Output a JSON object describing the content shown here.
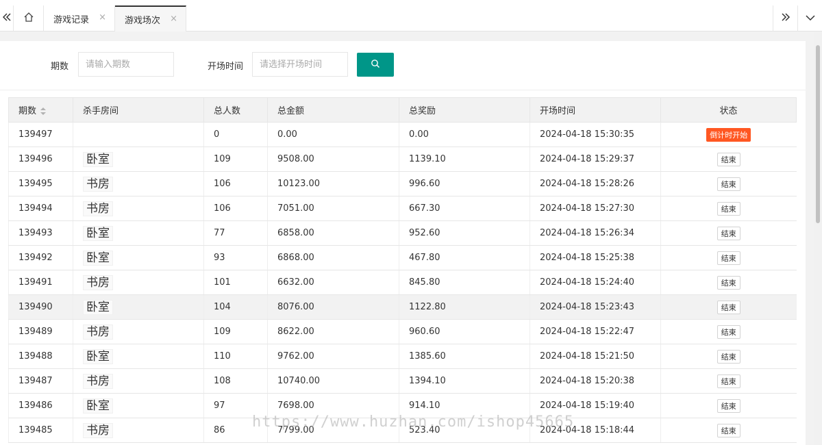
{
  "tabs": [
    {
      "label": "游戏记录",
      "close": "×",
      "active": false
    },
    {
      "label": "游戏场次",
      "close": "×",
      "active": true
    }
  ],
  "icons": {
    "prev": "chevron-double-left-icon",
    "home": "home-icon",
    "next": "chevron-double-right-icon",
    "dropdown": "chevron-down-icon",
    "search": "search-icon"
  },
  "search": {
    "period_label": "期数",
    "period_placeholder": "请输入期数",
    "time_label": "开场时间",
    "time_placeholder": "请选择开场时间"
  },
  "colors": {
    "accent": "#009688",
    "active_badge": "#ff5722"
  },
  "table": {
    "headers": [
      "期数",
      "杀手房间",
      "总人数",
      "总金额",
      "总奖励",
      "开场时间",
      "状态"
    ],
    "rows": [
      {
        "period": "139497",
        "room": "",
        "players": "0",
        "amount": "0.00",
        "reward": "0.00",
        "time": "2024-04-18 15:30:35",
        "status": "倒计时开始",
        "status_type": "active"
      },
      {
        "period": "139496",
        "room": "卧室",
        "players": "109",
        "amount": "9508.00",
        "reward": "1139.10",
        "time": "2024-04-18 15:29:37",
        "status": "结束",
        "status_type": "end"
      },
      {
        "period": "139495",
        "room": "书房",
        "players": "106",
        "amount": "10123.00",
        "reward": "996.60",
        "time": "2024-04-18 15:28:26",
        "status": "结束",
        "status_type": "end"
      },
      {
        "period": "139494",
        "room": "书房",
        "players": "106",
        "amount": "7051.00",
        "reward": "667.30",
        "time": "2024-04-18 15:27:30",
        "status": "结束",
        "status_type": "end"
      },
      {
        "period": "139493",
        "room": "卧室",
        "players": "77",
        "amount": "6858.00",
        "reward": "952.60",
        "time": "2024-04-18 15:26:34",
        "status": "结束",
        "status_type": "end"
      },
      {
        "period": "139492",
        "room": "卧室",
        "players": "93",
        "amount": "6868.00",
        "reward": "467.80",
        "time": "2024-04-18 15:25:38",
        "status": "结束",
        "status_type": "end"
      },
      {
        "period": "139491",
        "room": "书房",
        "players": "101",
        "amount": "6632.00",
        "reward": "845.80",
        "time": "2024-04-18 15:24:40",
        "status": "结束",
        "status_type": "end"
      },
      {
        "period": "139490",
        "room": "卧室",
        "players": "104",
        "amount": "8076.00",
        "reward": "1122.80",
        "time": "2024-04-18 15:23:43",
        "status": "结束",
        "status_type": "end",
        "highlight": true
      },
      {
        "period": "139489",
        "room": "书房",
        "players": "109",
        "amount": "8622.00",
        "reward": "960.60",
        "time": "2024-04-18 15:22:47",
        "status": "结束",
        "status_type": "end"
      },
      {
        "period": "139488",
        "room": "卧室",
        "players": "110",
        "amount": "9762.00",
        "reward": "1385.60",
        "time": "2024-04-18 15:21:50",
        "status": "结束",
        "status_type": "end"
      },
      {
        "period": "139487",
        "room": "书房",
        "players": "108",
        "amount": "10740.00",
        "reward": "1394.10",
        "time": "2024-04-18 15:20:38",
        "status": "结束",
        "status_type": "end"
      },
      {
        "period": "139486",
        "room": "卧室",
        "players": "97",
        "amount": "7698.00",
        "reward": "914.10",
        "time": "2024-04-18 15:19:40",
        "status": "结束",
        "status_type": "end"
      },
      {
        "period": "139485",
        "room": "书房",
        "players": "86",
        "amount": "7799.00",
        "reward": "523.40",
        "time": "2024-04-18 15:18:44",
        "status": "结束",
        "status_type": "end"
      }
    ]
  },
  "watermark": "https://www.huzhan.com/ishop45665"
}
